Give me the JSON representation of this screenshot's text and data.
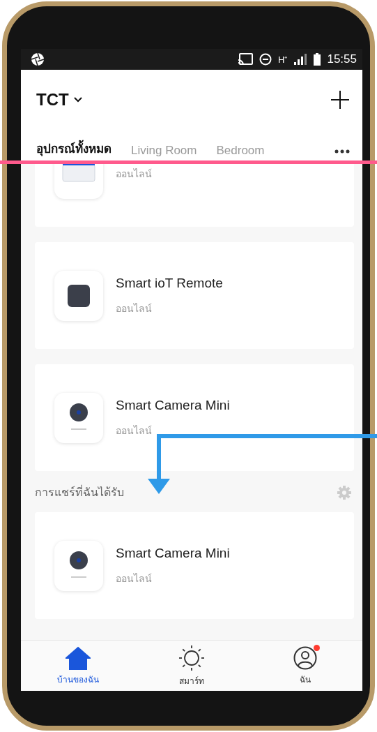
{
  "status_bar": {
    "network": "H⁺",
    "time": "15:55"
  },
  "header": {
    "home": "TCT"
  },
  "tabs": [
    {
      "label": "อุปกรณ์ทั้งหมด",
      "selected": true
    },
    {
      "label": "Living Room",
      "selected": false
    },
    {
      "label": "Bedroom",
      "selected": false
    }
  ],
  "devices": [
    {
      "kind": "panel",
      "status": "ออนไลน์"
    },
    {
      "kind": "remote",
      "name": "Smart ioT Remote",
      "status": "ออนไลน์"
    },
    {
      "kind": "camera",
      "name": "Smart Camera Mini",
      "status": "ออนไลน์"
    }
  ],
  "shared": {
    "title": "การแชร์ที่ฉันได้รับ",
    "devices": [
      {
        "kind": "camera",
        "name": "Smart Camera Mini",
        "status": "ออนไลน์"
      }
    ]
  },
  "bottom_nav": [
    {
      "kind": "home",
      "label": "บ้านของฉัน",
      "selected": true,
      "notification": false
    },
    {
      "kind": "smart",
      "label": "สมาร์ท",
      "selected": false,
      "notification": false
    },
    {
      "kind": "me",
      "label": "ฉัน",
      "selected": false,
      "notification": true
    }
  ]
}
